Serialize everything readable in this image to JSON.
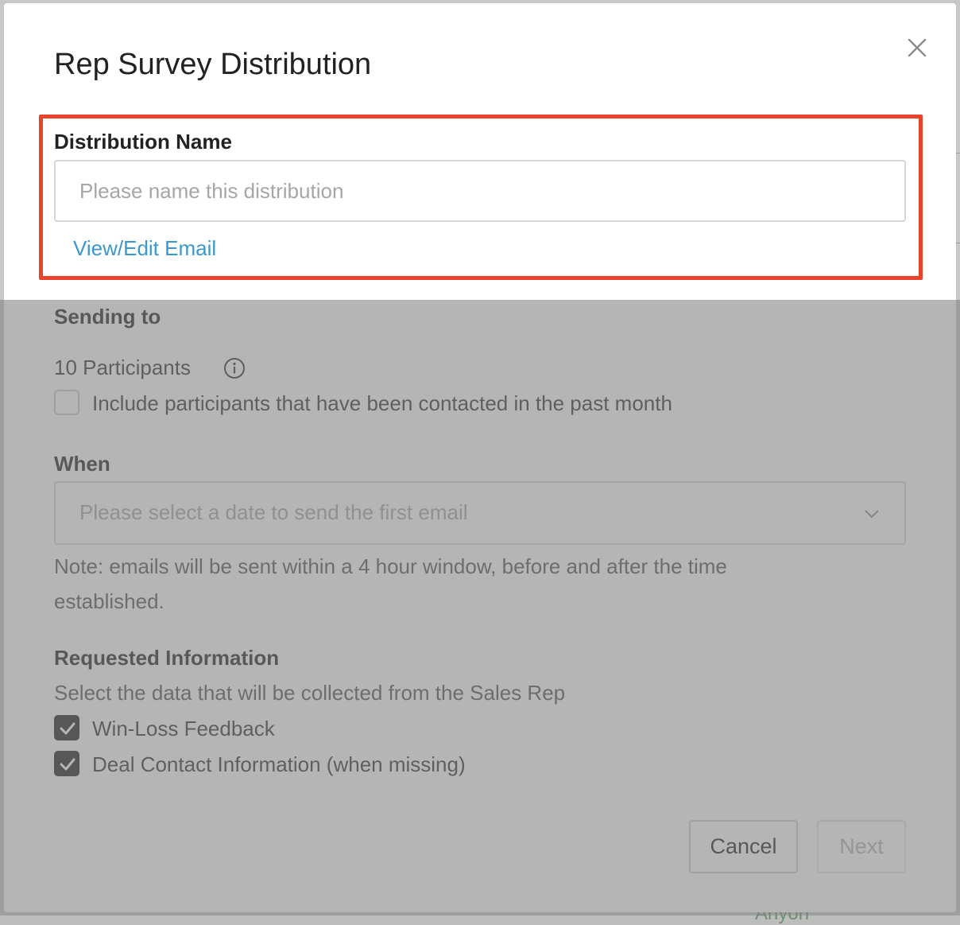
{
  "modal": {
    "title": "Rep Survey Distribution",
    "close_icon": "close-icon"
  },
  "distribution_name": {
    "label": "Distribution Name",
    "placeholder": "Please name this distribution",
    "value": "",
    "view_edit_link": "View/Edit Email"
  },
  "sending_to": {
    "label": "Sending to",
    "participants": "10 Participants",
    "info_icon": "info-icon",
    "include_past_month_label": "Include participants that have been contacted in the past month",
    "include_past_month_checked": false
  },
  "when": {
    "label": "When",
    "placeholder": "Please select a date to send the first email",
    "chevron_icon": "chevron-down-icon",
    "note": "Note: emails will be sent within a 4 hour window, before and after the time established."
  },
  "requested_information": {
    "label": "Requested Information",
    "description": "Select the data that will be collected from the Sales Rep",
    "options": [
      {
        "label": "Win-Loss Feedback",
        "checked": true
      },
      {
        "label": "Deal Contact Information (when missing)",
        "checked": true
      }
    ]
  },
  "footer": {
    "cancel_label": "Cancel",
    "next_label": "Next"
  },
  "background": {
    "partial_text": "Anyon"
  },
  "colors": {
    "highlight_border": "#e8432b",
    "link": "#3b98cc",
    "checkbox_checked": "#1f1f1f"
  }
}
